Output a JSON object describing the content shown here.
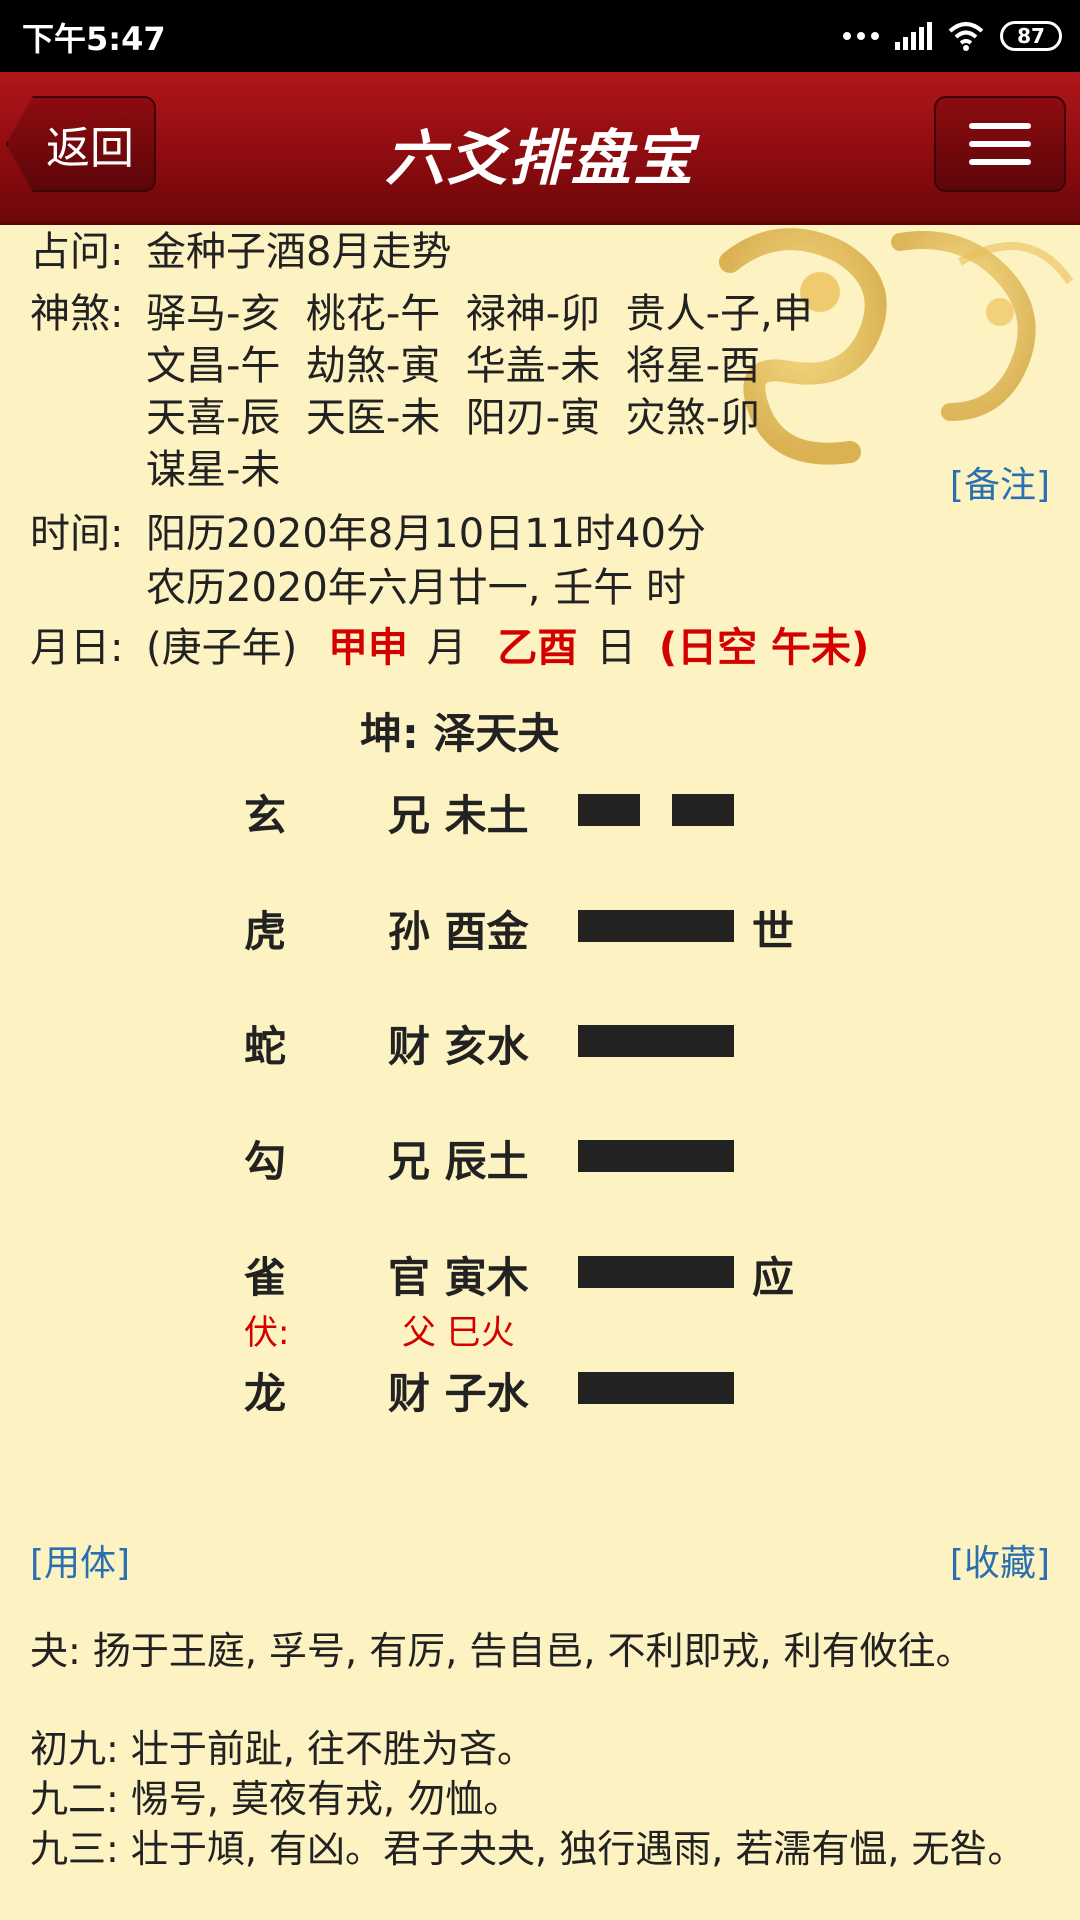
{
  "status_bar": {
    "time": "下午5:47",
    "battery": "87"
  },
  "header": {
    "back_label": "返回",
    "title": "六爻排盘宝"
  },
  "info": {
    "question_label": "占问:",
    "question": "金种子酒8月走势",
    "shensha_label": "神煞:",
    "shensha_lines": [
      "驿马-亥  桃花-午  禄神-卯  贵人-子,申",
      "文昌-午  劫煞-寅  华盖-未  将星-酉",
      "天喜-辰  天医-未  阳刃-寅  灾煞-卯",
      "谋星-未"
    ],
    "note_link": "[备注]",
    "time_label": "时间:",
    "solar": "阳历2020年8月10日11时40分",
    "lunar": "农历2020年六月廿一, 壬午 时",
    "day_label": "月日:",
    "year_part": "(庚子年)",
    "month_gz": "甲申",
    "month_char": "月",
    "day_gz": "乙酉",
    "day_char": "日",
    "kong": "(日空 午未)"
  },
  "hexagram": {
    "name": "坤: 泽天夬",
    "lines": [
      {
        "god": "玄",
        "relation": "兄 未土",
        "type": "yin",
        "mark": ""
      },
      {
        "god": "虎",
        "relation": "孙 酉金",
        "type": "yang",
        "mark": "世"
      },
      {
        "god": "蛇",
        "relation": "财 亥水",
        "type": "yang",
        "mark": ""
      },
      {
        "god": "勾",
        "relation": "兄 辰土",
        "type": "yang",
        "mark": ""
      },
      {
        "god": "雀",
        "relation": "官 寅木",
        "type": "yang",
        "mark": "应"
      },
      {
        "god": "龙",
        "relation": "财 子水",
        "type": "yang",
        "mark": ""
      }
    ],
    "fu_label": "伏:",
    "fu_value": "父 巳火"
  },
  "links": {
    "yongti": "[用体]",
    "favorite": "[收藏]"
  },
  "text": [
    "夬: 扬于王庭, 孚号, 有厉, 告自邑, 不利即戎, 利有攸往。",
    "初九: 壮于前趾, 往不胜为吝。",
    "九二: 惕号, 莫夜有戎, 勿恤。",
    "九三: 壮于頄, 有凶。君子夬夬, 独行遇雨, 若濡有愠, 无咎。"
  ],
  "colors": {
    "header": "#9a0f13",
    "background": "#fdf3c2",
    "accent_red": "#d40000",
    "link": "#2a6fb0"
  }
}
